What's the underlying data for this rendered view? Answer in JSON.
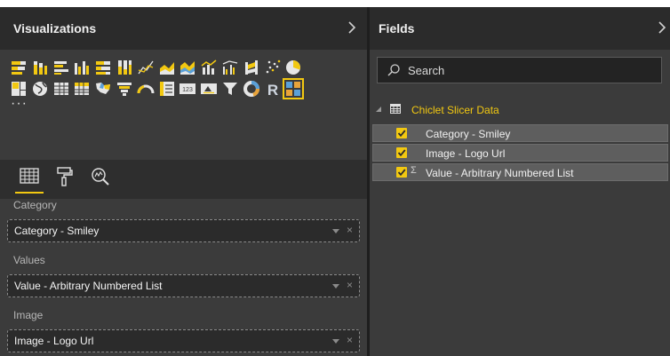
{
  "visualizations_pane": {
    "title": "Visualizations",
    "gallery": {
      "row1": [
        "stacked-bar-icon",
        "stacked-column-icon",
        "clustered-bar-icon",
        "clustered-column-icon",
        "100-stacked-bar-icon",
        "100-stacked-column-icon",
        "line-chart-icon",
        "area-chart-icon",
        "stacked-area-icon",
        "line-column-icon",
        "line-clustered-column-icon",
        "ribbon-chart-icon",
        "scatter-chart-icon",
        "pie-chart-icon"
      ],
      "row2": [
        "treemap-icon",
        "map-icon",
        "table-icon",
        "matrix-icon",
        "filled-map-icon",
        "funnel-icon",
        "gauge-icon",
        "multi-row-card-icon",
        "card-icon",
        "kpi-icon",
        "slicer-icon",
        "donut-chart-icon",
        "r-script-visual-icon",
        "chiclet-slicer-icon"
      ],
      "more_label": "···",
      "selected": "chiclet-slicer-icon"
    },
    "tabs": [
      "fields-tab",
      "format-tab",
      "analytics-tab"
    ],
    "wells": [
      {
        "label": "Category",
        "value": "Category - Smiley"
      },
      {
        "label": "Values",
        "value": "Value - Arbitrary Numbered List"
      },
      {
        "label": "Image",
        "value": "Image - Logo Url"
      }
    ],
    "remove_glyph": "×"
  },
  "fields_pane": {
    "title": "Fields",
    "search_placeholder": "Search",
    "table_name": "Chiclet Slicer Data",
    "fields": [
      {
        "name": "Category - Smiley",
        "checked": true,
        "sigma": ""
      },
      {
        "name": "Image - Logo Url",
        "checked": true,
        "sigma": ""
      },
      {
        "name": "Value - Arbitrary Numbered List",
        "checked": true,
        "sigma": "Σ"
      }
    ]
  },
  "colors": {
    "accent": "#f2c811",
    "pane_bg": "#3b3b3b",
    "header_bg": "#2b2b2b"
  }
}
